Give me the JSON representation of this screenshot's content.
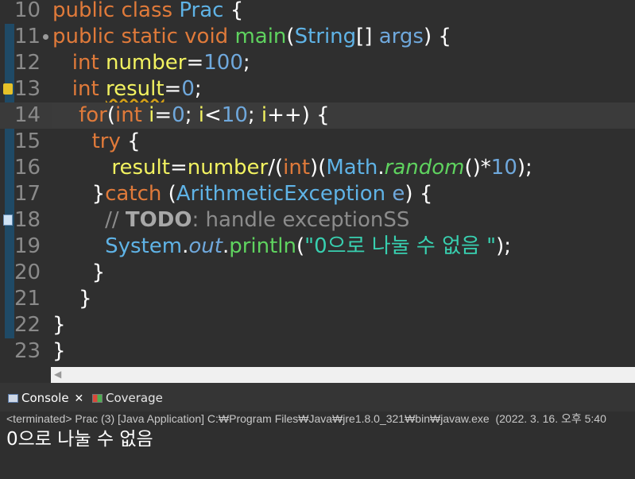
{
  "editor": {
    "lines": [
      {
        "num": "10",
        "tokens": [
          [
            "k",
            "public class "
          ],
          [
            "t",
            "Prac"
          ],
          [
            "p",
            " {"
          ]
        ]
      },
      {
        "num": "11",
        "tokens": [
          [
            "k",
            "public static void "
          ],
          [
            "m",
            "main"
          ],
          [
            "p",
            "("
          ],
          [
            "t",
            "String"
          ],
          [
            "p",
            "[] "
          ],
          [
            "n",
            "args"
          ],
          [
            "p",
            ") {"
          ]
        ]
      },
      {
        "num": "12",
        "tokens": [
          [
            "p",
            "   "
          ],
          [
            "k",
            "int "
          ],
          [
            "v",
            "number"
          ],
          [
            "p",
            "="
          ],
          [
            "n",
            "100"
          ],
          [
            "p",
            ";"
          ]
        ]
      },
      {
        "num": "13",
        "tokens": [
          [
            "p",
            "   "
          ],
          [
            "k",
            "int "
          ],
          [
            "v",
            "result"
          ],
          [
            "p",
            "="
          ],
          [
            "n",
            "0"
          ],
          [
            "p",
            ";"
          ]
        ]
      },
      {
        "num": "14",
        "tokens": [
          [
            "p",
            "    "
          ],
          [
            "k",
            "for"
          ],
          [
            "p",
            "("
          ],
          [
            "k",
            "int "
          ],
          [
            "v",
            "i"
          ],
          [
            "p",
            "="
          ],
          [
            "n",
            "0"
          ],
          [
            "p",
            "; "
          ],
          [
            "v",
            "i"
          ],
          [
            "p",
            "<"
          ],
          [
            "n",
            "10"
          ],
          [
            "p",
            "; "
          ],
          [
            "v",
            "i"
          ],
          [
            "p",
            "++) {"
          ]
        ]
      },
      {
        "num": "15",
        "tokens": [
          [
            "p",
            "      "
          ],
          [
            "k",
            "try"
          ],
          [
            "p",
            " {"
          ]
        ]
      },
      {
        "num": "16",
        "tokens": [
          [
            "p",
            "         "
          ],
          [
            "v",
            "result"
          ],
          [
            "p",
            "="
          ],
          [
            "v",
            "number"
          ],
          [
            "p",
            "/("
          ],
          [
            "k",
            "int"
          ],
          [
            "p",
            ")("
          ],
          [
            "t",
            "Math"
          ],
          [
            "p",
            "."
          ],
          [
            "m",
            "random"
          ],
          [
            "p",
            "()*"
          ],
          [
            "n",
            "10"
          ],
          [
            "p",
            ");"
          ]
        ]
      },
      {
        "num": "17",
        "tokens": [
          [
            "p",
            "      }"
          ],
          [
            "k",
            "catch"
          ],
          [
            "p",
            " ("
          ],
          [
            "t",
            "ArithmeticException"
          ],
          [
            "p",
            " "
          ],
          [
            "n",
            "e"
          ],
          [
            "p",
            ") {"
          ]
        ]
      },
      {
        "num": "18",
        "tokens": [
          [
            "c",
            "        // "
          ],
          [
            "ct",
            "TODO"
          ],
          [
            "c",
            ": handle exceptionSS"
          ]
        ]
      },
      {
        "num": "19",
        "tokens": [
          [
            "p",
            "        "
          ],
          [
            "t",
            "System"
          ],
          [
            "p",
            "."
          ],
          [
            "n",
            "out"
          ],
          [
            "p",
            "."
          ],
          [
            "m",
            "println"
          ],
          [
            "p",
            "("
          ],
          [
            "s",
            "\"0으로 나눌 수 없음 \""
          ],
          [
            "p",
            ");"
          ]
        ]
      },
      {
        "num": "20",
        "tokens": [
          [
            "p",
            "      }"
          ]
        ]
      },
      {
        "num": "21",
        "tokens": [
          [
            "p",
            "    }"
          ]
        ]
      },
      {
        "num": "22",
        "tokens": [
          [
            "p",
            "}"
          ]
        ]
      },
      {
        "num": "23",
        "tokens": [
          [
            "p",
            "}"
          ]
        ]
      }
    ]
  },
  "console_panel": {
    "tabs": [
      {
        "label": "Console",
        "icon": "console-icon",
        "active": true,
        "close": "✕"
      },
      {
        "label": "Coverage",
        "icon": "coverage-icon",
        "active": false
      }
    ],
    "status": "<terminated> Prac (3) [Java Application] C:₩Program Files₩Java₩jre1.8.0_321₩bin₩javaw.exe  (2022. 3. 16. 오후 5:40",
    "output": "0으로 나눌 수 없음"
  },
  "scrollbar": {
    "left_arrow": "◀"
  },
  "colors": {
    "background": "#2f2f2f",
    "keyword": "#e07a3a",
    "type": "#5fb3e6",
    "method": "#5fd35f",
    "variable": "#f2f260",
    "number": "#6fa8dc",
    "string": "#38d0b0",
    "comment": "#8c8c8c"
  }
}
